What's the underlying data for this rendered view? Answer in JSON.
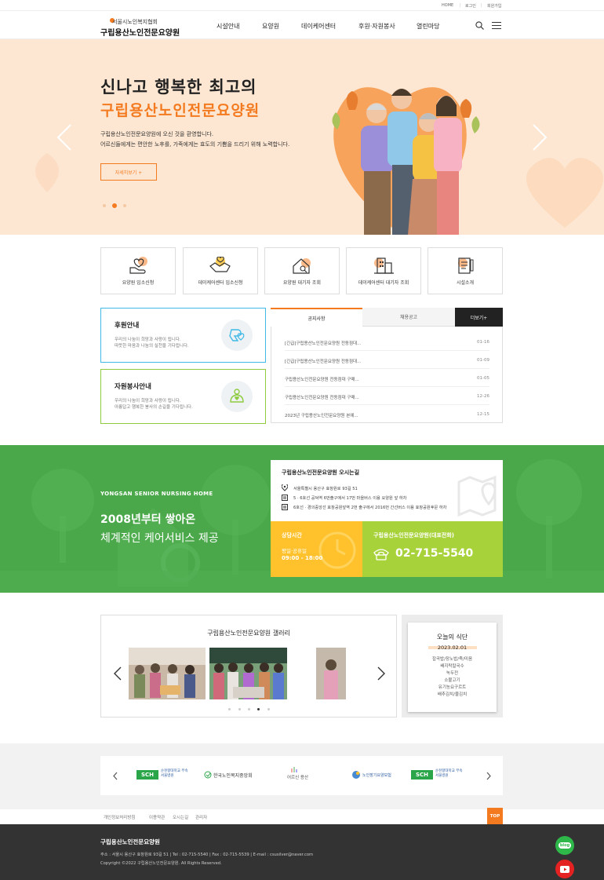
{
  "util": {
    "home": "HOME",
    "login": "로그인",
    "join": "회원가입",
    "sep": "|"
  },
  "header": {
    "logo_sub": "서울시노인복지협회",
    "logo_main": "구립용산노인전문요양원",
    "nav": [
      "시설안내",
      "요양원",
      "데이케어센터",
      "후원·자원봉사",
      "열린마당"
    ]
  },
  "hero": {
    "title1": "신나고 행복한 최고의",
    "title2": "구립용산노인전문요양원",
    "desc1": "구립용산노인전문요양원에 오신 것을 환영합니다.",
    "desc2": "어르신들에게는 편안한 노후를, 가족에게는 효도의 기쁨을 드리기 위해 노력합니다.",
    "button": "자세히보기 +"
  },
  "quick_menu": [
    "요양원 입소신청",
    "데이케어센터 입소신청",
    "요양원 대기자 조회",
    "데이케어센터 대기자 조회",
    "시설소개"
  ],
  "support": {
    "donation": {
      "title": "후원안내",
      "line1": "우리의 나눔이 희망과 사랑이 됩니다.",
      "line2": "따뜻한 마음과 나눔의 실천을 기다립니다."
    },
    "volunteer": {
      "title": "자원봉사안내",
      "line1": "우리의 나눔이 희망과 사랑이 됩니다.",
      "line2": "아름답고 행복한 봉사의 손길을 기다립니다."
    }
  },
  "notice": {
    "tabs": [
      "공지사항",
      "채용공고"
    ],
    "more": "더보기+",
    "items": [
      {
        "title": "[긴급]구립용산노인전문요양원 전동점대...",
        "date": "01-16"
      },
      {
        "title": "[긴급]구립용산노인전문요양원 전동점대...",
        "date": "01-09"
      },
      {
        "title": "구립용산노인전문요양원 전동점대 구매...",
        "date": "01-05"
      },
      {
        "title": "구립용산노인전문요양원 전동점대 구매...",
        "date": "12-26"
      },
      {
        "title": "2023년 구립용산노인전문요양원 본예...",
        "date": "12-15"
      }
    ]
  },
  "band": {
    "en": "YONGSAN SENIOR NURSING HOME",
    "line1": "2008년부터 쌓아온",
    "line2": "체계적인 케어서비스 제공"
  },
  "location": {
    "title": "구립용산노인전문요양원 오시는길",
    "address": "서울특별시 용산구 효창원로 93길 51",
    "transit1": "5 · 6호선 공덕역 6번출구에서 17번 마을버스 이용 요양원 앞 하차",
    "transit2": "6호선 · 경의중앙선 효창공원앞역 2번 출구에서 2016번 간선버스 이용 효창공원후문 하차"
  },
  "hours": {
    "title": "상담시간",
    "days": "평일·공휴일",
    "time": "09:00 - 18:00"
  },
  "phone": {
    "title": "구립용산노인전문요양원(대표전화)",
    "number": "02-715-5540"
  },
  "gallery": {
    "title": "구립용산노인전문요양원 갤러리"
  },
  "meal": {
    "title": "오늘의 식단",
    "date": "2023.02.01",
    "items": [
      "잡곡밥/장노밥/죽/미음",
      "배지락칼국수",
      "녹두전",
      "소불고기",
      "유기농요구르트",
      "배추김치/물김치"
    ]
  },
  "partners": [
    {
      "name": "순천향대학교 부속\n서울병원",
      "mark": "SCH"
    },
    {
      "name": "한국노인복지중앙회",
      "mark": ""
    },
    {
      "name": "어르신 용산",
      "mark": ""
    },
    {
      "name": "노인장기요양보험",
      "mark": ""
    },
    {
      "name": "순천향대학교 부속\n서울병원",
      "mark": "SCH"
    }
  ],
  "footer_links": [
    "개인정보처리방침",
    "이용약관",
    "오시는길",
    "관리자"
  ],
  "top": "TOP",
  "footer": {
    "name": "구립용산노인전문요양원",
    "address": "주소 : 서울시 용산구 효창원로 93길 51  |  Tel : 02-715-5540  |  Fax : 02-715-5539  |  E-mail : csusilver@naver.com",
    "copyright": "Copyright ©2022 구립용산노인전문요양원. All Rights Reserved."
  },
  "sns": {
    "blog": "blog"
  },
  "colors": {
    "brand": "#f47a20",
    "green": "#4aa84a",
    "yellow": "#ffc22c",
    "lime": "#a8d23a",
    "peach": "#fde7d2"
  }
}
